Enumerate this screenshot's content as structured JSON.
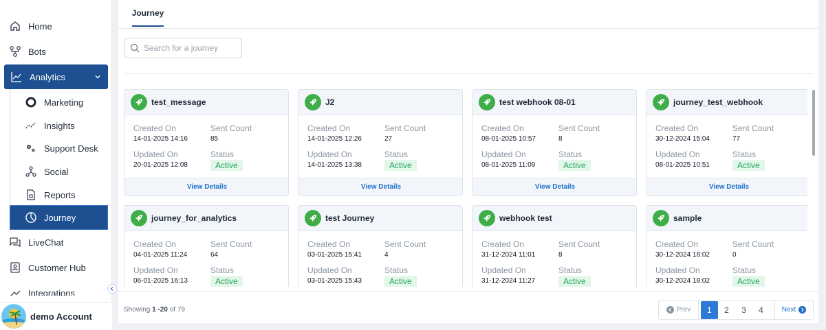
{
  "sidebar": {
    "items": [
      {
        "label": "Home",
        "icon": "home-icon"
      },
      {
        "label": "Bots",
        "icon": "bots-icon"
      },
      {
        "label": "Analytics",
        "icon": "analytics-icon"
      },
      {
        "label": "Marketing",
        "icon": "marketing-icon"
      },
      {
        "label": "Insights",
        "icon": "insights-icon"
      },
      {
        "label": "Support Desk",
        "icon": "support-desk-icon"
      },
      {
        "label": "Social",
        "icon": "social-icon"
      },
      {
        "label": "Reports",
        "icon": "reports-icon"
      },
      {
        "label": "Journey",
        "icon": "journey-icon"
      },
      {
        "label": "LiveChat",
        "icon": "livechat-icon"
      },
      {
        "label": "Customer Hub",
        "icon": "customer-hub-icon"
      },
      {
        "label": "Integrations",
        "icon": "integrations-icon"
      }
    ],
    "account": {
      "name": "demo Account"
    }
  },
  "header": {
    "tab": "Journey"
  },
  "search": {
    "placeholder": "Search for a journey",
    "value": ""
  },
  "card_labels": {
    "created_on": "Created On",
    "sent_count": "Sent Count",
    "updated_on": "Updated On",
    "status": "Status",
    "view_details": "View Details"
  },
  "journeys": [
    {
      "name": "test_message",
      "created": "14-01-2025 14:16",
      "sent": "85",
      "updated": "20-01-2025 12:08",
      "status": "Active"
    },
    {
      "name": "J2",
      "created": "14-01-2025 12:26",
      "sent": "27",
      "updated": "14-01-2025 13:38",
      "status": "Active"
    },
    {
      "name": "test webhook 08-01",
      "created": "08-01-2025 10:57",
      "sent": "8",
      "updated": "08-01-2025 11:09",
      "status": "Active"
    },
    {
      "name": "journey_test_webhook",
      "created": "30-12-2024 15:04",
      "sent": "77",
      "updated": "08-01-2025 10:51",
      "status": "Active"
    },
    {
      "name": "journey_for_analytics",
      "created": "04-01-2025 11:24",
      "sent": "64",
      "updated": "06-01-2025 16:13",
      "status": "Active"
    },
    {
      "name": "test Journey",
      "created": "03-01-2025 15:41",
      "sent": "4",
      "updated": "03-01-2025 15:43",
      "status": "Active"
    },
    {
      "name": "webhook test",
      "created": "31-12-2024 11:01",
      "sent": "8",
      "updated": "31-12-2024 11:27",
      "status": "Active"
    },
    {
      "name": "sample",
      "created": "30-12-2024 18:02",
      "sent": "0",
      "updated": "30-12-2024 18:02",
      "status": "Active"
    }
  ],
  "footer": {
    "showing_prefix": "Showing ",
    "showing_range": "1 -20",
    "showing_suffix": " of 79",
    "prev": "Prev",
    "next": "Next",
    "pages": [
      "1",
      "2",
      "3",
      "4"
    ],
    "current_page": "1"
  },
  "colors": {
    "primary": "#1d4f91",
    "status_active": "#22a55a",
    "rocket": "#3fae49",
    "link": "#1d6fc9"
  }
}
